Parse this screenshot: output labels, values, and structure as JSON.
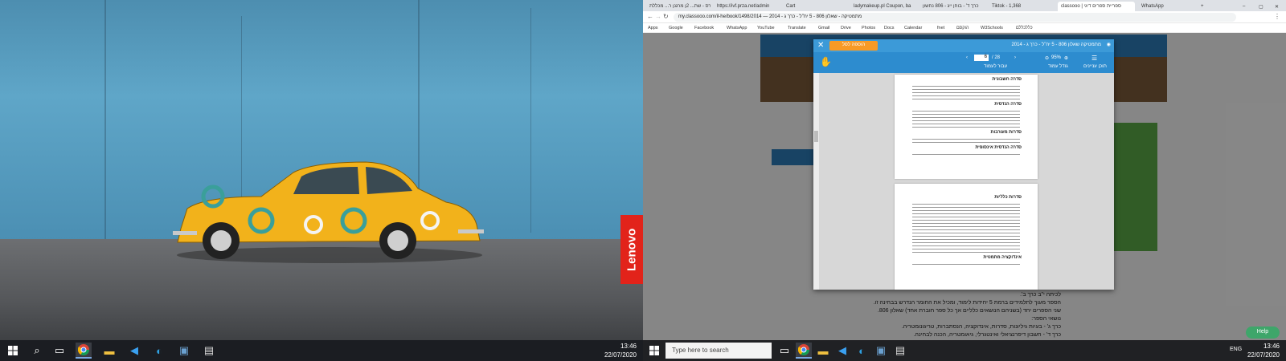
{
  "left_monitor": {
    "brand": "Lenovo",
    "taskbar": {
      "time": "13:46",
      "date": "22/07/2020"
    }
  },
  "browser": {
    "tabs": [
      "קורס - שת... 2ן מרגנן ר... מכללת",
      "https://ivf.prza.net/admin",
      "Cart",
      "ladymakeup.pl Coupon, ba",
      "כרך ד' - בוחן ייג - 806 נחשון",
      "Tiktok - 1,368",
      "classooo | ספריית ספרים דיגי",
      "WhatsApp"
    ],
    "url": "my.classooo.com/il-he/book/1498/2014 — מתמטיקה - שאלון 806 - 5 יח\"ל - כרך ג - 2014",
    "bookmarks": [
      "Apps",
      "Google",
      "Facebook",
      "WhatsApp",
      "YouTube",
      "Translate",
      "Gmail",
      "Drive",
      "Photos",
      "Docs",
      "Calendar",
      "fnet",
      "הוקסם",
      "W3Schools",
      "כללכללם"
    ]
  },
  "modal": {
    "title": "מתמטיקה שאלון 806 - 5 יח\"ל - כרך ג - 2014",
    "add_to_cart": "הוספה לסל",
    "page_current": "6",
    "page_total": "/ 28",
    "page_nav_label": "עבור לעמוד",
    "zoom": "95%",
    "zoom_label": "גודל עמוד",
    "toc_label": "תוכן עניינים",
    "sheet1_headings": [
      "סדרה חשבונית",
      "סדרה הנדסית",
      "סדרות מעורבות",
      "סדרה הנדסית אינסופית"
    ],
    "sheet2_headings": [
      "סדרות כלליות",
      "אינדוקציה מתמטית"
    ]
  },
  "right_taskbar": {
    "search_placeholder": "Type here to search",
    "time": "13:46",
    "date": "22/07/2020",
    "lang": "ENG"
  },
  "help_button": "Help",
  "page_bottom_text": [
    "ספר זה, המוגש בשני כרכים (כרך ג, כרך ד) הוא המשך של הספר - שאלונים 804 ו- 806 לכיתה י\"ב כרך ב'.",
    "הספר מעוך לתלמידים ברמת 5 יחידות לימוד, ומכיל את החומר הנדרש בבחינה זו.",
    "שני הספרים יחד (בשניהם הנושאים כלליים אך כל ספר חוברת אחד) שאלון 806.",
    "נושאי הספר:",
    "כרך ג' - בעיות גיליונות, סדרות, אינדוקציה, הנסתברות, טריגונומטריה.",
    "כרך ד' - חשבון דיפרנציאלי ואינטגרלי, גיאומטריה, הכנה לבחינה."
  ]
}
